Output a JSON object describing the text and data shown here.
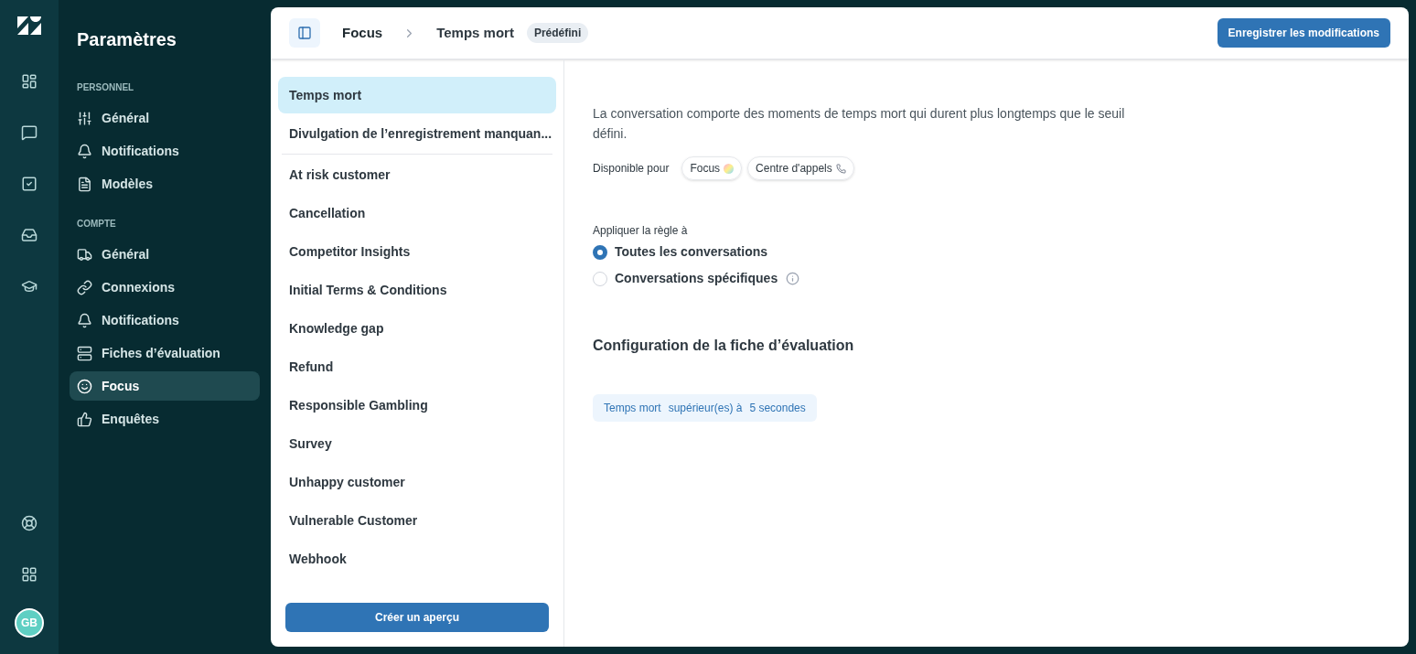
{
  "rail": {
    "avatar": "GB"
  },
  "sidebar": {
    "title": "Paramètres",
    "sections": [
      {
        "heading": "PERSONNEL",
        "items": [
          {
            "label": "Général",
            "selected": false
          },
          {
            "label": "Notifications",
            "selected": false
          },
          {
            "label": "Modèles",
            "selected": false
          }
        ]
      },
      {
        "heading": "COMPTE",
        "items": [
          {
            "label": "Général",
            "selected": false
          },
          {
            "label": "Connexions",
            "selected": false
          },
          {
            "label": "Notifications",
            "selected": false
          },
          {
            "label": "Fiches d’évaluation",
            "selected": false
          },
          {
            "label": "Focus",
            "selected": true
          },
          {
            "label": "Enquêtes",
            "selected": false
          }
        ]
      }
    ]
  },
  "header": {
    "breadcrumb": [
      "Focus",
      "Temps mort"
    ],
    "badge": "Prédéfini",
    "save_button": "Enregistrer les modifications"
  },
  "rule_groups": [
    {
      "items": [
        {
          "label": "Temps mort",
          "selected": true
        },
        {
          "label": "Divulgation de l’enregistrement manquan...",
          "selected": false
        }
      ]
    },
    {
      "items": [
        {
          "label": "At risk customer",
          "selected": false
        },
        {
          "label": "Cancellation",
          "selected": false
        },
        {
          "label": "Competitor Insights",
          "selected": false
        },
        {
          "label": "Initial Terms & Conditions",
          "selected": false
        },
        {
          "label": "Knowledge gap",
          "selected": false
        },
        {
          "label": "Refund",
          "selected": false
        },
        {
          "label": "Responsible Gambling",
          "selected": false
        },
        {
          "label": "Survey",
          "selected": false
        },
        {
          "label": "Unhappy customer",
          "selected": false
        },
        {
          "label": "Vulnerable Customer",
          "selected": false
        },
        {
          "label": "Webhook",
          "selected": false
        }
      ]
    }
  ],
  "create_button": "Créer un aperçu",
  "detail": {
    "description": "La conversation comporte des moments de temps mort qui durent plus longtemps que le seuil défini.",
    "available_label": "Disponible pour",
    "available_for": [
      {
        "label": "Focus",
        "kind": "focus"
      },
      {
        "label": "Centre d'appels",
        "kind": "call"
      }
    ],
    "apply_label": "Appliquer la règle à",
    "options": [
      {
        "label": "Toutes les conversations",
        "selected": true,
        "info": false
      },
      {
        "label": "Conversations spécifiques",
        "selected": false,
        "info": true
      }
    ],
    "config_title": "Configuration de la fiche d’évaluation",
    "condition": {
      "metric": "Temps mort",
      "operator": "supérieur(es) à",
      "value": "5 secondes"
    }
  }
}
